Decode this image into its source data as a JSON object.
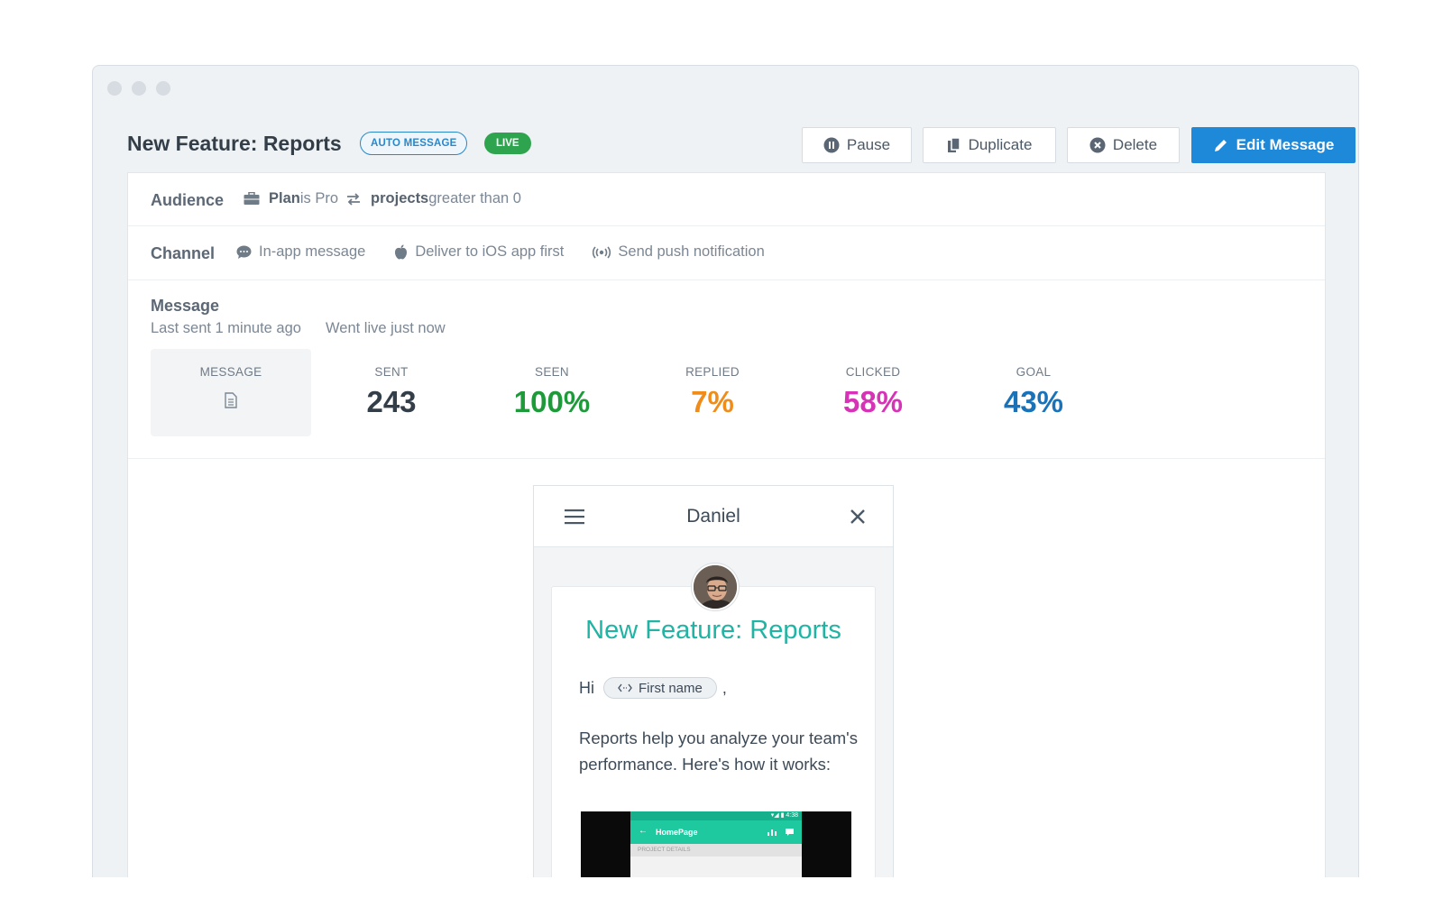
{
  "header": {
    "title": "New Feature: Reports",
    "badge_auto": "AUTO MESSAGE",
    "badge_live": "LIVE",
    "pause_label": "Pause",
    "duplicate_label": "Duplicate",
    "delete_label": "Delete",
    "edit_label": "Edit Message"
  },
  "audience": {
    "label": "Audience",
    "rule1_attr": "Plan",
    "rule1_op": " is Pro",
    "rule2_attr": "projects",
    "rule2_op": " greater than 0"
  },
  "channel": {
    "label": "Channel",
    "items": [
      "In-app message",
      "Deliver to iOS app first",
      "Send push notification"
    ]
  },
  "message": {
    "label": "Message",
    "last_sent": "Last sent 1 minute ago",
    "went_live": "Went live just now",
    "stats": [
      {
        "label": "MESSAGE",
        "value": ""
      },
      {
        "label": "SENT",
        "value": "243",
        "color": "#333e48"
      },
      {
        "label": "SEEN",
        "value": "100%",
        "color": "#1f9a3b"
      },
      {
        "label": "REPLIED",
        "value": "7%",
        "color": "#f08c1a"
      },
      {
        "label": "CLICKED",
        "value": "58%",
        "color": "#d633b6"
      },
      {
        "label": "GOAL",
        "value": "43%",
        "color": "#1a72b8"
      }
    ]
  },
  "preview": {
    "sender_name": "Daniel",
    "card_title": "New Feature: Reports",
    "greeting": "Hi",
    "attribute_chip": "First name",
    "greeting_suffix": ",",
    "body": "Reports help you analyze your team's performance. Here's how it works:",
    "screenshot_status": "▾◢ ▮ 4:38",
    "screenshot_title": "HomePage",
    "screenshot_sub": "PROJECT DETAILS"
  },
  "colors": {
    "accent": "#1e88d9",
    "live": "#2ea44f",
    "teal": "#21b3a3"
  }
}
